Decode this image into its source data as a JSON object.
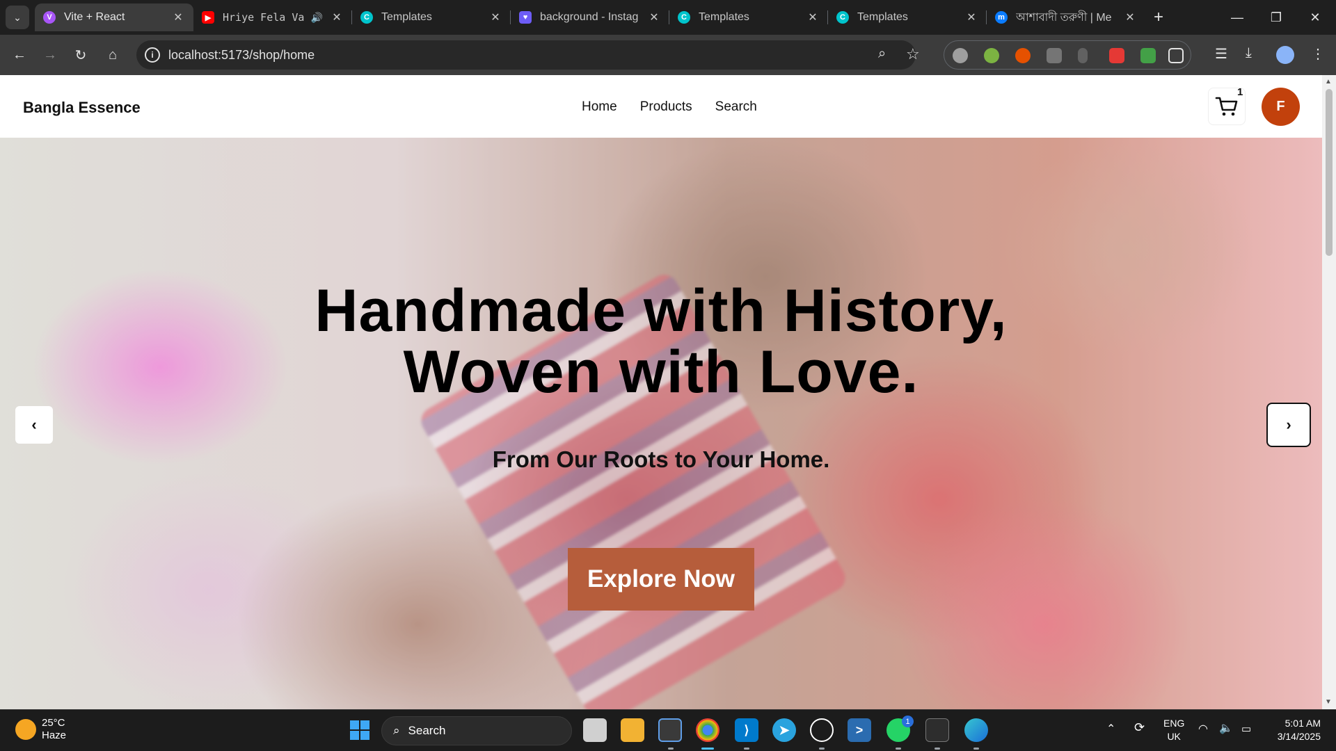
{
  "browser": {
    "tabs": [
      {
        "title": "Vite + React",
        "favicon": "vite-icon",
        "color": "#a855f7",
        "active": true
      },
      {
        "title": "Hriye Fela Va",
        "favicon": "youtube-icon",
        "color": "#ff0000",
        "audio": true
      },
      {
        "title": "Templates",
        "favicon": "canva-icon",
        "color": "#00c4cc"
      },
      {
        "title": "background - Instag",
        "favicon": "instagram-icon",
        "color": "#6d5cf6"
      },
      {
        "title": "Templates",
        "favicon": "canva-icon",
        "color": "#00c4cc"
      },
      {
        "title": "Templates",
        "favicon": "canva-icon",
        "color": "#00c4cc"
      },
      {
        "title": "আশাবাদী তরুণী | Me",
        "favicon": "messenger-icon",
        "color": "#0a7cff"
      }
    ],
    "url": "localhost:5173/shop/home"
  },
  "site": {
    "brand": "Bangla Essence",
    "nav": [
      "Home",
      "Products",
      "Search"
    ],
    "cart_count": "1",
    "avatar_initial": "F",
    "avatar_color": "#c2410c"
  },
  "hero": {
    "title_line1": "Handmade with History,",
    "title_line2": "Woven with Love.",
    "subtitle": "From Our Roots to Your Home.",
    "cta_label": "Explore Now",
    "cta_color": "#b65d3b"
  },
  "taskbar": {
    "weather_temp": "25°C",
    "weather_desc": "Haze",
    "search_label": "Search",
    "whatsapp_badge": "1",
    "lang_line1": "ENG",
    "lang_line2": "UK",
    "time": "5:01 AM",
    "date": "3/14/2025"
  }
}
